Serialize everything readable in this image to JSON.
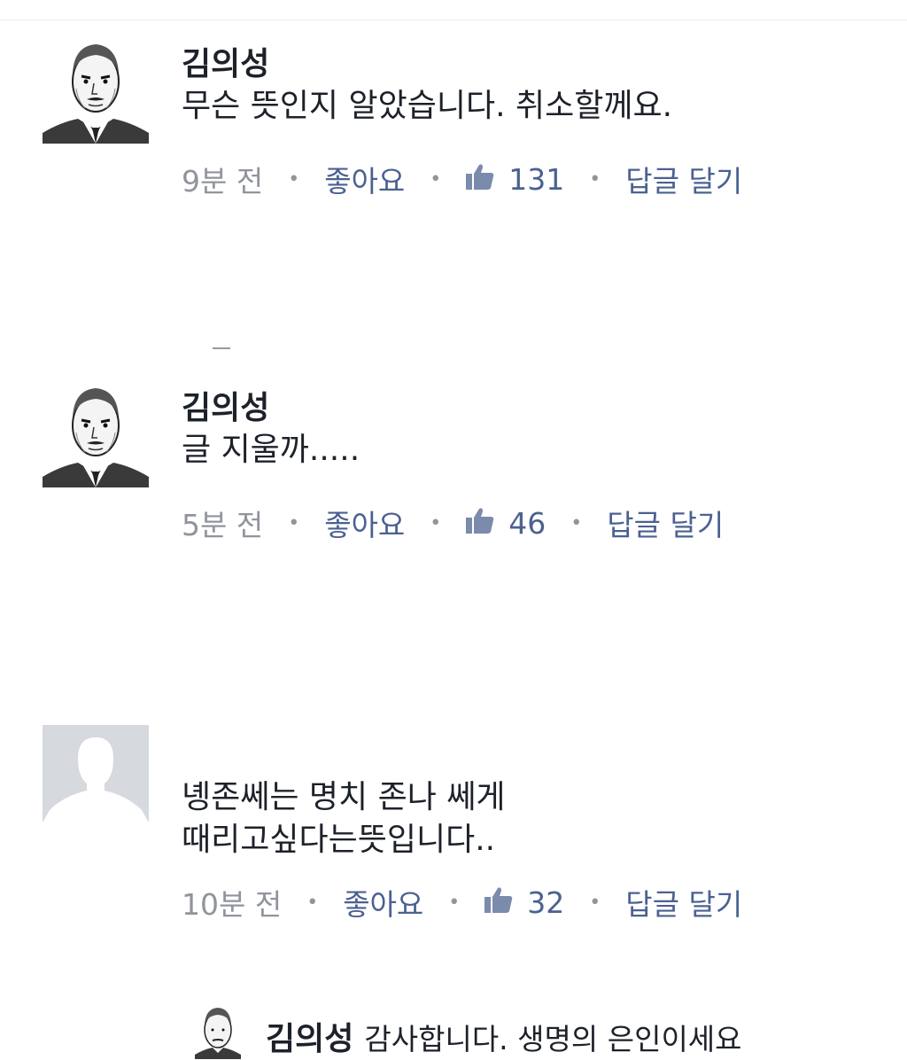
{
  "comments": [
    {
      "author": "김의성",
      "text": "무슨 뜻인지 알았습니다. 취소할께요.",
      "time": "9분 전",
      "like_label": "좋아요",
      "like_count": "131",
      "reply_label": "답글 달기",
      "avatar": "illustrated-portrait"
    },
    {
      "author": "김의성",
      "text": "글 지울까.....",
      "time": "5분 전",
      "like_label": "좋아요",
      "like_count": "46",
      "reply_label": "답글 달기",
      "avatar": "illustrated-portrait"
    },
    {
      "author": "",
      "text_lines": [
        "녱존쎄는 명치 존나 쎄게",
        "때리고싶다는뜻입니다.."
      ],
      "time": "10분 전",
      "like_label": "좋아요",
      "like_count": "32",
      "reply_label": "답글 달기",
      "avatar": "default-silhouette"
    }
  ],
  "reply": {
    "author": "김의성",
    "text": "감사합니다. 생명의 은인이세요",
    "avatar": "illustrated-portrait"
  },
  "icons": {
    "like": "thumbs-up-icon",
    "separator": "dot-separator"
  },
  "colors": {
    "link": "#4b6191",
    "meta_gray": "#90949c",
    "text": "#1d2129",
    "placeholder_avatar_bg": "#d6d9dd"
  }
}
